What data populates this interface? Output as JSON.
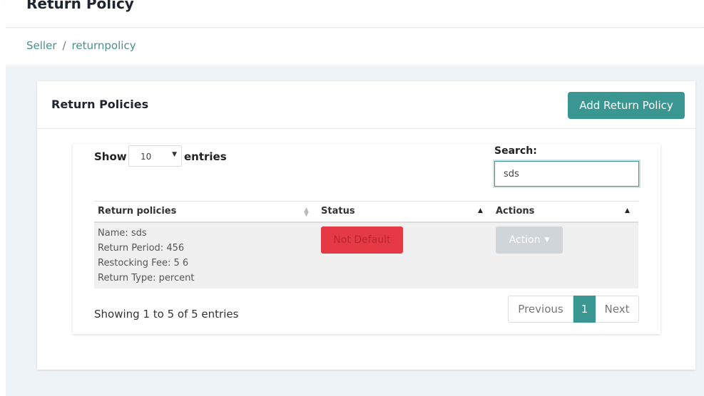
{
  "header": {
    "title": "Return Policy"
  },
  "breadcrumb": {
    "items": [
      "Seller",
      "returnpolicy"
    ]
  },
  "card": {
    "title": "Return Policies",
    "add_button": "Add Return Policy"
  },
  "table_controls": {
    "show_label": "Show",
    "length_value": "10",
    "entries_label": "entries",
    "search_label": "Search:",
    "search_value": "sds"
  },
  "table": {
    "columns": [
      "Return policies",
      "Status",
      "Actions"
    ],
    "rows": [
      {
        "policy_lines": [
          "Name: sds",
          "Return Period: 456",
          "Restocking Fee: 5 6",
          "Return Type: percent"
        ],
        "status": "Not Default",
        "action": "Action"
      }
    ]
  },
  "footer": {
    "info": "Showing 1 to 5 of 5 entries",
    "prev": "Previous",
    "current_page": "1",
    "next": "Next"
  }
}
